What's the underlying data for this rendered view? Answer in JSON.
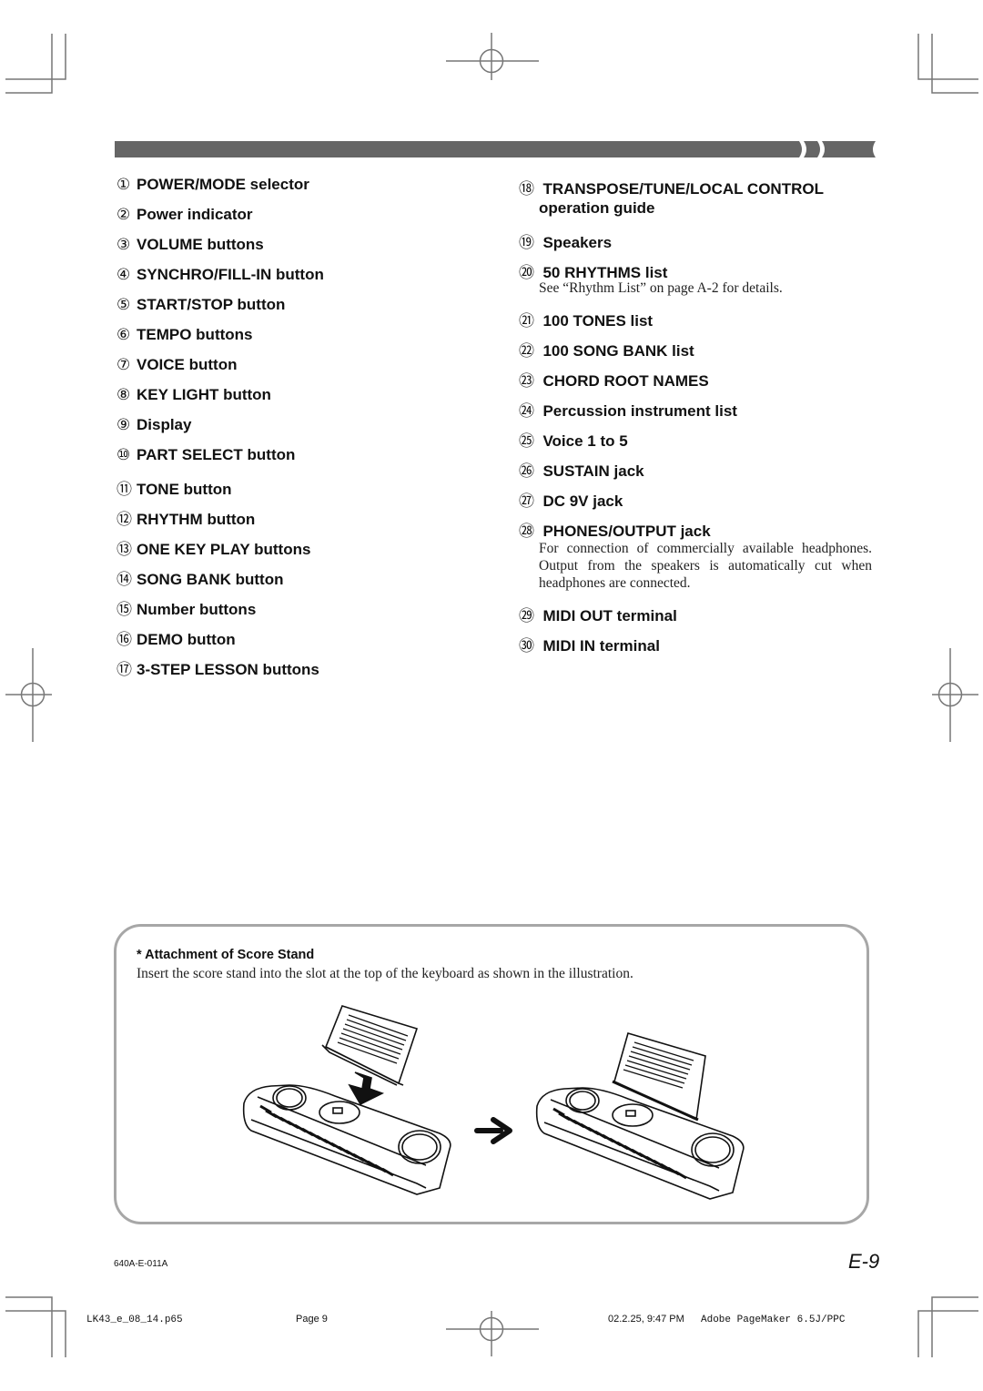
{
  "header": {
    "bar_color": "#666666"
  },
  "left_items": [
    {
      "num": "①",
      "label": "POWER/MODE selector"
    },
    {
      "num": "②",
      "label": "Power indicator"
    },
    {
      "num": "③",
      "label": "VOLUME buttons"
    },
    {
      "num": "④",
      "label": "SYNCHRO/FILL-IN button"
    },
    {
      "num": "⑤",
      "label": "START/STOP button"
    },
    {
      "num": "⑥",
      "label": "TEMPO buttons"
    },
    {
      "num": "⑦",
      "label": "VOICE button"
    },
    {
      "num": "⑧",
      "label": "KEY LIGHT button"
    },
    {
      "num": "⑨",
      "label": "Display"
    },
    {
      "num": "⑩",
      "label": "PART SELECT button"
    },
    {
      "num": "⑪",
      "label": "TONE button"
    },
    {
      "num": "⑫",
      "label": "RHYTHM button"
    },
    {
      "num": "⑬",
      "label": "ONE KEY PLAY buttons"
    },
    {
      "num": "⑭",
      "label": "SONG BANK button"
    },
    {
      "num": "⑮",
      "label": "Number buttons"
    },
    {
      "num": "⑯",
      "label": "DEMO button"
    },
    {
      "num": "⑰",
      "label": "3-STEP LESSON buttons"
    }
  ],
  "right_items": {
    "i18": {
      "num": "⑱",
      "label": "TRANSPOSE/TUNE/LOCAL CONTROL",
      "label_line2": "operation guide"
    },
    "i19": {
      "num": "⑲",
      "label": "Speakers"
    },
    "i20": {
      "num": "⑳",
      "label": "50 RHYTHMS list",
      "desc": "See “Rhythm List” on page A-2 for details."
    },
    "i21": {
      "num": "㉑",
      "label": "100 TONES list"
    },
    "i22": {
      "num": "㉒",
      "label": "100 SONG BANK list"
    },
    "i23": {
      "num": "㉓",
      "label": "CHORD ROOT NAMES"
    },
    "i24": {
      "num": "㉔",
      "label": "Percussion instrument list"
    },
    "i25": {
      "num": "㉕",
      "label": "Voice 1 to 5"
    },
    "i26": {
      "num": "㉖",
      "label": "SUSTAIN jack"
    },
    "i27": {
      "num": "㉗",
      "label": "DC 9V jack"
    },
    "i28": {
      "num": "㉘",
      "label": "PHONES/OUTPUT jack",
      "desc": "For connection of commercially available headphones. Output from the speakers is automatically cut when headphones are connected."
    },
    "i29": {
      "num": "㉙",
      "label": "MIDI OUT terminal"
    },
    "i30": {
      "num": "㉚",
      "label": "MIDI IN terminal"
    }
  },
  "score_stand": {
    "title": "* Attachment of Score Stand",
    "text": "Insert the score stand into the slot at the top of the keyboard as shown in the illustration.",
    "illustrations": [
      "keyboard-with-stand-inserting",
      "arrow-right",
      "keyboard-with-stand-attached"
    ]
  },
  "footer": {
    "code": "640A-E-011A",
    "page_id": "E-9",
    "slug_file": "LK43_e_08_14.p65",
    "slug_page": "Page 9",
    "slug_date": "02.2.25, 9:47 PM",
    "slug_app": "Adobe PageMaker 6.5J/PPC"
  }
}
